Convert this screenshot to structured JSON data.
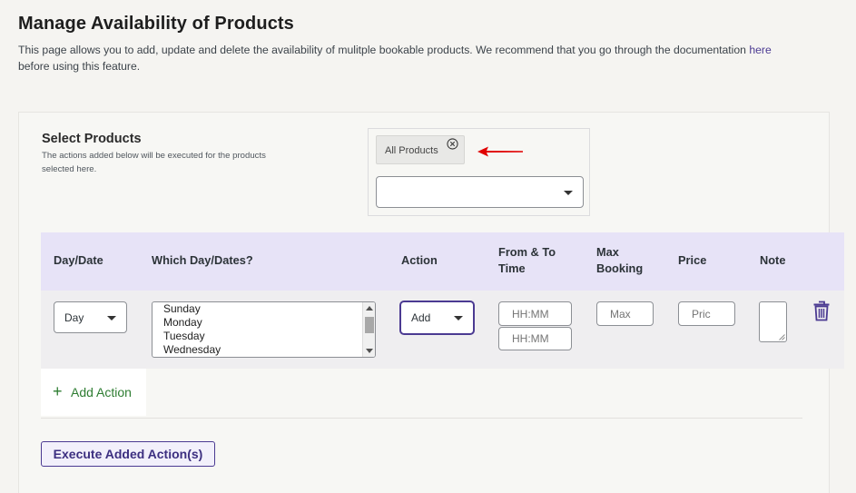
{
  "header": {
    "title": "Manage Availability of Products",
    "description": "This page allows you to add, update and delete the availability of mulitple bookable products. We recommend that you go through the documentation ",
    "description_link": "here",
    "description_after": "before using this feature."
  },
  "select_products": {
    "title": "Select Products",
    "help": "The actions added below will be executed for the products selected here.",
    "chips": [
      {
        "label": "All Products",
        "remove_icon": "circle-x-icon"
      }
    ],
    "select_value": "",
    "annotation": "red-arrow-pointing-left"
  },
  "table": {
    "columns": [
      "Day/Date",
      "Which Day/Dates?",
      "Action",
      "From & To Time",
      "Max Booking",
      "Price",
      "Note"
    ],
    "rows": [
      {
        "day_date": "Day",
        "which_days": [
          "Sunday",
          "Monday",
          "Tuesday",
          "Wednesday"
        ],
        "action": "Add",
        "from_placeholder": "HH:MM",
        "to_placeholder": "HH:MM",
        "max_booking_placeholder": "Max",
        "price_placeholder": "Pric",
        "note": "",
        "delete_icon": "trash-icon"
      }
    ]
  },
  "buttons": {
    "add_action": "Add Action",
    "add_action_icon": "+",
    "execute": "Execute Added Action(s)"
  },
  "colors": {
    "accent": "#4b3a92",
    "table_header_bg": "#e7e3f7",
    "add_action_green": "#2e7d32",
    "annotation_red": "#e00000"
  }
}
